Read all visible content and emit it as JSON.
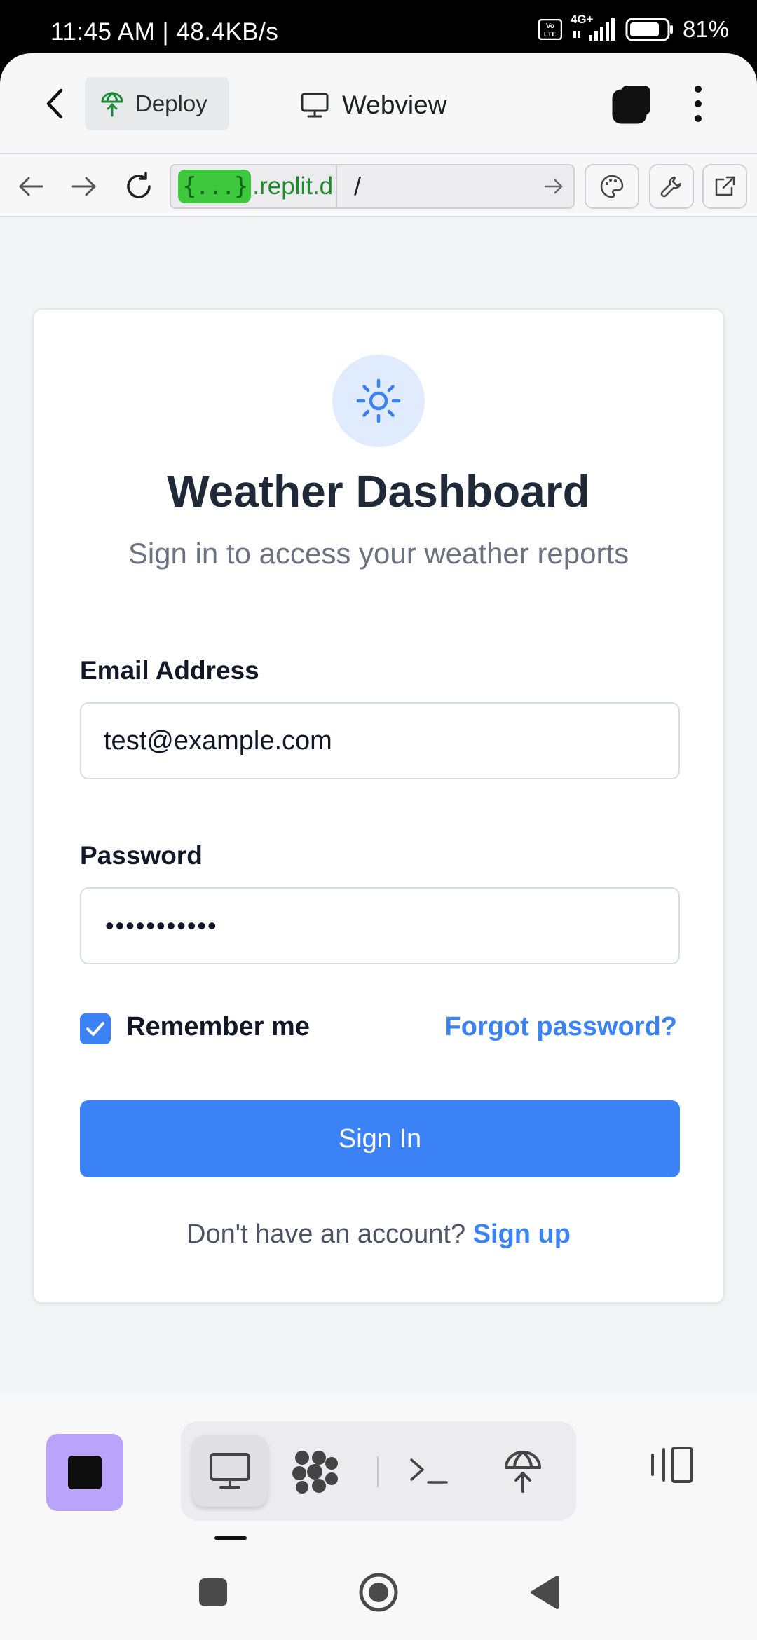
{
  "status_bar": {
    "time": "11:45 AM | 48.4KB/s",
    "network": "4G+",
    "battery": "81%",
    "battery_level": 0.81
  },
  "app_bar": {
    "deploy_label": "Deploy",
    "webview_label": "Webview",
    "icons": [
      "back-icon",
      "deploy-icon",
      "monitor-icon",
      "tabs-icon",
      "more-icon"
    ]
  },
  "url_bar": {
    "badge": "{...}",
    "domain": ".replit.d",
    "path": "/",
    "icons": [
      "nav-back-icon",
      "nav-forward-icon",
      "reload-icon",
      "go-icon",
      "palette-icon",
      "wrench-icon",
      "external-link-icon"
    ]
  },
  "page": {
    "title": "Weather Dashboard",
    "subtitle": "Sign in to access your weather reports",
    "email_label": "Email Address",
    "email_value": "test@example.com",
    "password_label": "Password",
    "password_mask": "•••••••••••",
    "remember_label": "Remember me",
    "remember_checked": true,
    "forgot_label": "Forgot password?",
    "signin_label": "Sign In",
    "signup_prompt": "Don't have an account?",
    "signup_link": "Sign up",
    "accent_color": "#3b82f6"
  },
  "bottom_bar": {
    "icons": [
      "stop-icon",
      "monitor-icon",
      "agent-icon",
      "terminal-icon",
      "deploy-icon",
      "layout-icon"
    ],
    "stop_color": "#b9a3fb"
  },
  "nav_bar": {
    "icons": [
      "recents-icon",
      "home-icon",
      "back-icon"
    ]
  }
}
